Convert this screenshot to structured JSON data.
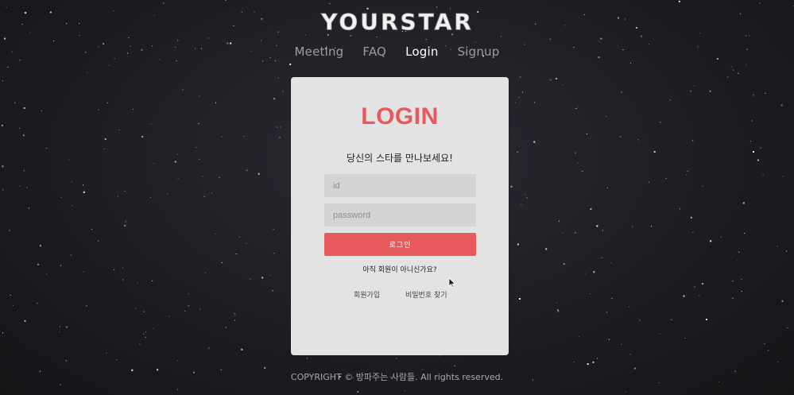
{
  "brand": {
    "logo_text": "YOURSTAR"
  },
  "nav": {
    "items": [
      {
        "label": "Meeting",
        "active": false
      },
      {
        "label": "FAQ",
        "active": false
      },
      {
        "label": "Login",
        "active": true
      },
      {
        "label": "Signup",
        "active": false
      }
    ]
  },
  "login_card": {
    "title": "LOGIN",
    "subtitle": "당신의 스타를 만나보세요!",
    "id_placeholder": "id",
    "password_placeholder": "password",
    "submit_label": "로그인",
    "signup_prompt": "아직 회원이 아니신가요?",
    "signup_link": "회원가입",
    "find_password_link": "비밀번호 찾기"
  },
  "footer": {
    "copyright": "COPYRIGHT © 방파주는 사람들. All rights reserved."
  },
  "colors": {
    "accent": "#e65a5e",
    "background": "#1c1c20",
    "card": "#e3e3e4",
    "input": "#d4d4d5"
  }
}
